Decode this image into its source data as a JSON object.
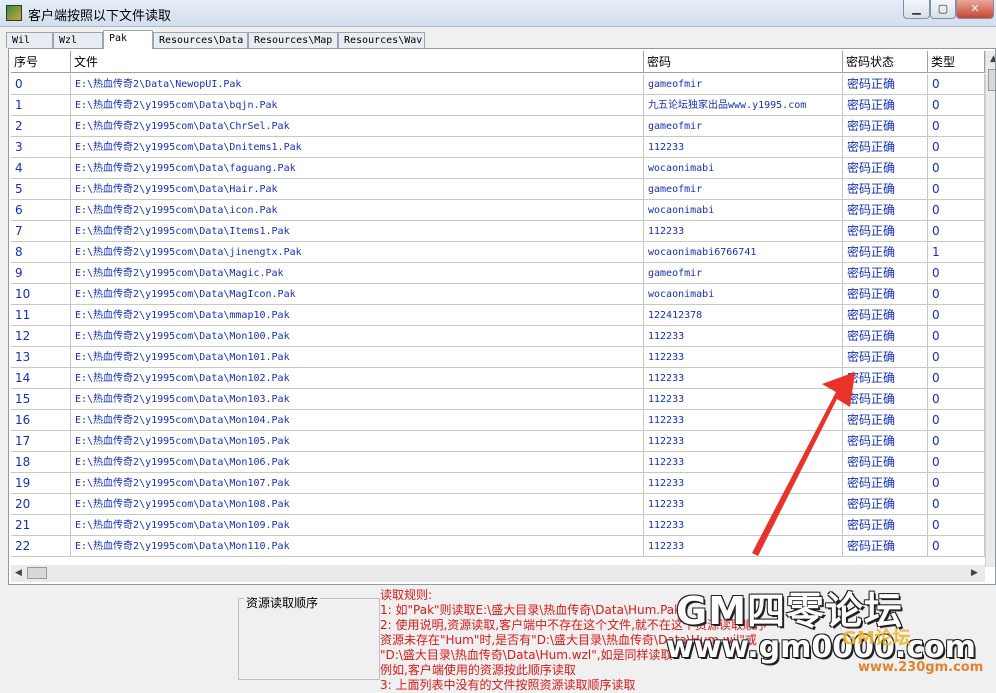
{
  "window": {
    "title": "客户端按照以下文件读取",
    "min": "▁",
    "max": "▢",
    "close": "✕"
  },
  "tabs": [
    "Wil",
    "Wzl",
    "Pak",
    "Resources\\Data",
    "Resources\\Map",
    "Resources\\Wav"
  ],
  "active_tab": "Pak",
  "table": {
    "columns": [
      "序号",
      "文件",
      "密码",
      "密码状态",
      "类型"
    ],
    "rows": [
      [
        "0",
        "E:\\热血传奇2\\Data\\NewopUI.Pak",
        "gameofmir",
        "密码正确",
        "0"
      ],
      [
        "1",
        "E:\\热血传奇2\\y1995com\\Data\\bqjn.Pak",
        "九五论坛独家出品www.y1995.com",
        "密码正确",
        "0"
      ],
      [
        "2",
        "E:\\热血传奇2\\y1995com\\Data\\ChrSel.Pak",
        "gameofmir",
        "密码正确",
        "0"
      ],
      [
        "3",
        "E:\\热血传奇2\\y1995com\\Data\\Dnitems1.Pak",
        "112233",
        "密码正确",
        "0"
      ],
      [
        "4",
        "E:\\热血传奇2\\y1995com\\Data\\faguang.Pak",
        "wocaonimabi",
        "密码正确",
        "0"
      ],
      [
        "5",
        "E:\\热血传奇2\\y1995com\\Data\\Hair.Pak",
        "gameofmir",
        "密码正确",
        "0"
      ],
      [
        "6",
        "E:\\热血传奇2\\y1995com\\Data\\icon.Pak",
        "wocaonimabi",
        "密码正确",
        "0"
      ],
      [
        "7",
        "E:\\热血传奇2\\y1995com\\Data\\Items1.Pak",
        "112233",
        "密码正确",
        "0"
      ],
      [
        "8",
        "E:\\热血传奇2\\y1995com\\Data\\jinengtx.Pak",
        "wocaonimabi6766741",
        "密码正确",
        "1"
      ],
      [
        "9",
        "E:\\热血传奇2\\y1995com\\Data\\Magic.Pak",
        "gameofmir",
        "密码正确",
        "0"
      ],
      [
        "10",
        "E:\\热血传奇2\\y1995com\\Data\\MagIcon.Pak",
        "wocaonimabi",
        "密码正确",
        "0"
      ],
      [
        "11",
        "E:\\热血传奇2\\y1995com\\Data\\mmap10.Pak",
        "122412378",
        "密码正确",
        "0"
      ],
      [
        "12",
        "E:\\热血传奇2\\y1995com\\Data\\Mon100.Pak",
        "112233",
        "密码正确",
        "0"
      ],
      [
        "13",
        "E:\\热血传奇2\\y1995com\\Data\\Mon101.Pak",
        "112233",
        "密码正确",
        "0"
      ],
      [
        "14",
        "E:\\热血传奇2\\y1995com\\Data\\Mon102.Pak",
        "112233",
        "密码正确",
        "0"
      ],
      [
        "15",
        "E:\\热血传奇2\\y1995com\\Data\\Mon103.Pak",
        "112233",
        "密码正确",
        "0"
      ],
      [
        "16",
        "E:\\热血传奇2\\y1995com\\Data\\Mon104.Pak",
        "112233",
        "密码正确",
        "0"
      ],
      [
        "17",
        "E:\\热血传奇2\\y1995com\\Data\\Mon105.Pak",
        "112233",
        "密码正确",
        "0"
      ],
      [
        "18",
        "E:\\热血传奇2\\y1995com\\Data\\Mon106.Pak",
        "112233",
        "密码正确",
        "0"
      ],
      [
        "19",
        "E:\\热血传奇2\\y1995com\\Data\\Mon107.Pak",
        "112233",
        "密码正确",
        "0"
      ],
      [
        "20",
        "E:\\热血传奇2\\y1995com\\Data\\Mon108.Pak",
        "112233",
        "密码正确",
        "0"
      ],
      [
        "21",
        "E:\\热血传奇2\\y1995com\\Data\\Mon109.Pak",
        "112233",
        "密码正确",
        "0"
      ],
      [
        "22",
        "E:\\热血传奇2\\y1995com\\Data\\Mon110.Pak",
        "112233",
        "密码正确",
        "0"
      ]
    ]
  },
  "resource_order_label": "资源读取顺序",
  "notes": [
    "读取规则:",
    "1: 如\"Pak\"则读取E:\\盛大目录\\热血传奇\\Data\\Hum.Pak",
    "2: 使用说明,资源读取,客户端中不存在这个文件,就不在这个资源读取顺序",
    "资源未存在\"Hum\"时,是否有\"D:\\盛大目录\\热血传奇\\Data\\Hum.wil\"或",
    "\"D:\\盛大目录\\热血传奇\\Data\\Hum.wzl\",如是同样读取一",
    "例如,客户端使用的资源按此顺序读取",
    "3: 上面列表中没有的文件按照资源读取顺序读取"
  ],
  "watermark": {
    "line1": "GM四零论坛",
    "line2": "www.gm0000.com",
    "line3": "GM论坛",
    "line4": "www.230gm.com"
  }
}
